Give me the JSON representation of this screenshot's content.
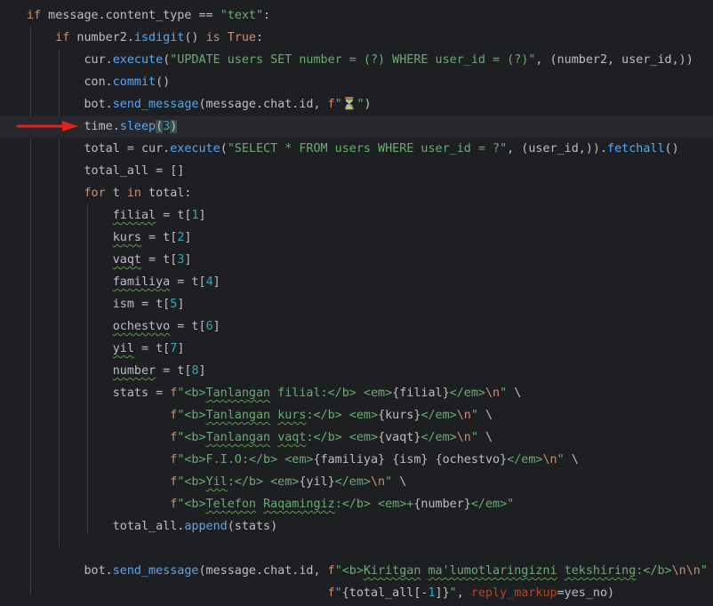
{
  "editor": {
    "language": "python",
    "theme_colors": {
      "background": "#1e1f22",
      "keyword": "#cf8e6d",
      "function": "#56a8f5",
      "string": "#6aab73",
      "number": "#2aacb8",
      "param": "#aa4926",
      "annotation_arrow": "#e0211d"
    },
    "arrow_icon": "red-arrow-right",
    "lines": [
      "if message.content_type == \"text\":",
      "    if number2.isdigit() is True:",
      "        cur.execute(\"UPDATE users SET number = (?) WHERE user_id = (?)\", (number2, user_id,))",
      "        con.commit()",
      "        bot.send_message(message.chat.id, f\"⏳\")",
      "        time.sleep(3)",
      "        total = cur.execute(\"SELECT * FROM users WHERE user_id = ?\", (user_id,)).fetchall()",
      "        total_all = []",
      "        for t in total:",
      "            filial = t[1]",
      "            kurs = t[2]",
      "            vaqt = t[3]",
      "            familiya = t[4]",
      "            ism = t[5]",
      "            ochestvo = t[6]",
      "            yil = t[7]",
      "            number = t[8]",
      "            stats = f\"<b>Tanlangan filial:</b> <em>{filial}</em>\\n\" \\",
      "                    f\"<b>Tanlangan kurs:</b> <em>{kurs}</em>\\n\" \\",
      "                    f\"<b>Tanlangan vaqt:</b> <em>{vaqt}</em>\\n\" \\",
      "                    f\"<b>F.I.O:</b> <em>{familiya} {ism} {ochestvo}</em>\\n\" \\",
      "                    f\"<b>Yil:</b> <em>{yil}</em>\\n\" \\",
      "                    f\"<b>Telefon Raqamingiz:</b> <em>+{number}</em>\"",
      "            total_all.append(stats)",
      "",
      "        bot.send_message(message.chat.id, f\"<b>Kiritgan ma'lumotlaringizni tekshiring:</b>\\n\\n\"",
      "                                          f\"{total_all[-1]}\", reply_markup=yes_no)"
    ]
  }
}
